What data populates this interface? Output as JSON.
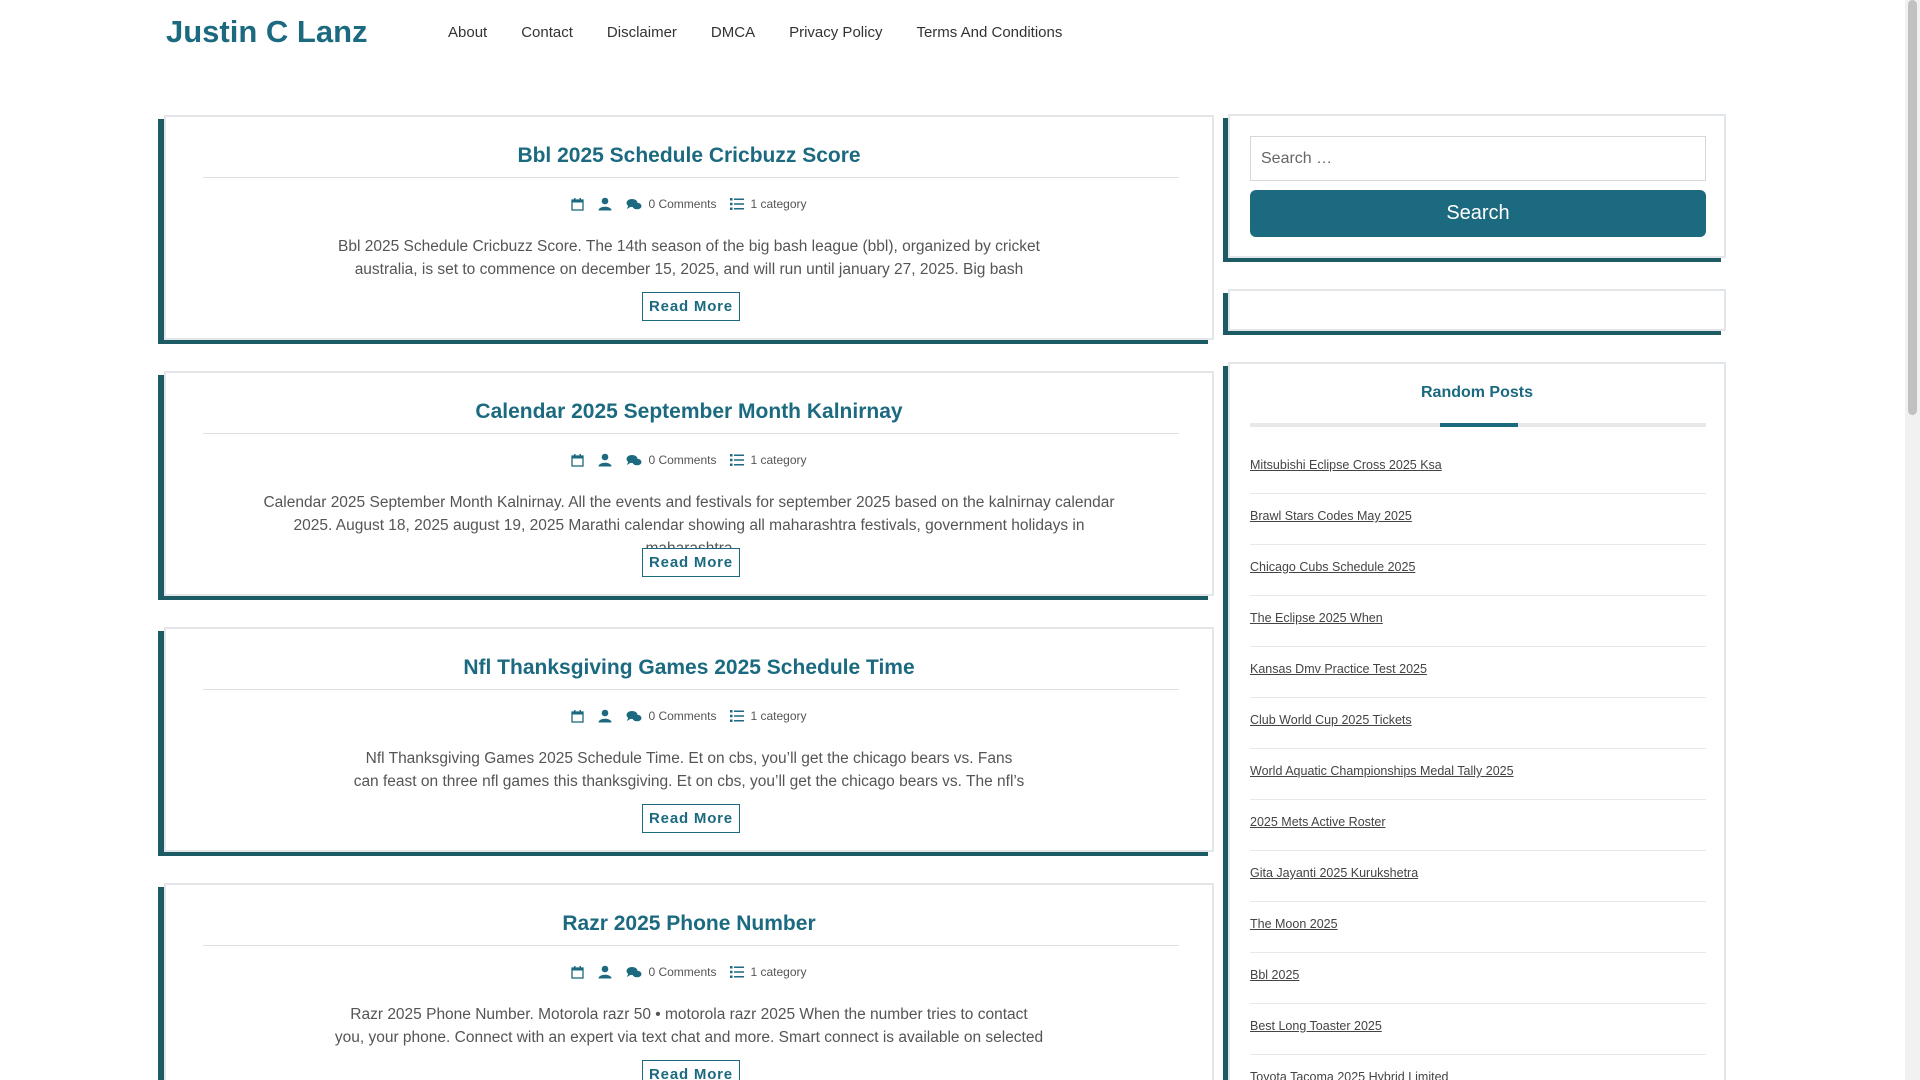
{
  "site": {
    "title": "Justin C Lanz"
  },
  "nav": [
    "About",
    "Contact",
    "Disclaimer",
    "DMCA",
    "Privacy Policy",
    "Terms And Conditions"
  ],
  "posts": [
    {
      "title": "Bbl 2025 Schedule Cricbuzz Score",
      "comments": "0 Comments",
      "category": "1 category",
      "excerpt_line1": "Bbl 2025 Schedule Cricbuzz Score. The 14th season of the big bash league (bbl), organized by cricket",
      "excerpt_line2": "australia, is set to commence on december 15, 2025, and will run until january 27, 2025. Big bash",
      "read_more": "Read More"
    },
    {
      "title": "Calendar 2025 September Month Kalnirnay",
      "comments": "0 Comments",
      "category": "1 category",
      "excerpt_line1": "Calendar 2025 September Month Kalnirnay. All the events and festivals for september 2025 based on the kalnirnay calendar",
      "excerpt_line2": "2025. August 18, 2025 august 19, 2025 Marathi calendar showing all maharashtra festivals, government holidays in maharashtra",
      "read_more": "Read More"
    },
    {
      "title": "Nfl Thanksgiving Games 2025 Schedule Time",
      "comments": "0 Comments",
      "category": "1 category",
      "excerpt_line1": "Nfl Thanksgiving Games 2025 Schedule Time. Et on cbs, you’ll get the chicago bears vs. Fans",
      "excerpt_line2": "can feast on three nfl games this thanksgiving. Et on cbs, you’ll get the chicago bears vs. The nfl’s",
      "read_more": "Read More"
    },
    {
      "title": "Razr 2025 Phone Number",
      "comments": "0 Comments",
      "category": "1 category",
      "excerpt_line1": "Razr 2025 Phone Number. Motorola razr 50 • motorola razr 2025 When the number tries to contact",
      "excerpt_line2": "you, your phone. Connect with an expert via text chat and more. Smart connect is available on selected",
      "read_more": "Read More"
    }
  ],
  "search": {
    "placeholder": "Search …",
    "button": "Search"
  },
  "random_posts": {
    "title": "Random Posts",
    "items": [
      "Mitsubishi Eclipse Cross 2025 Ksa",
      "Brawl Stars Codes May 2025",
      "Chicago Cubs Schedule 2025",
      "The Eclipse 2025 When",
      "Kansas Dmv Practice Test 2025",
      "Club World Cup 2025 Tickets",
      "World Aquatic Championships Medal Tally 2025",
      "2025 Mets Active Roster",
      "Gita Jayanti 2025 Kurukshetra",
      "The Moon 2025",
      "Bbl 2025",
      "Best Long Toaster 2025",
      "Toyota Tacoma 2025 Hybrid Limited"
    ]
  },
  "colors": {
    "accent": "#1c6a80",
    "shadow": "#1c5b64"
  }
}
